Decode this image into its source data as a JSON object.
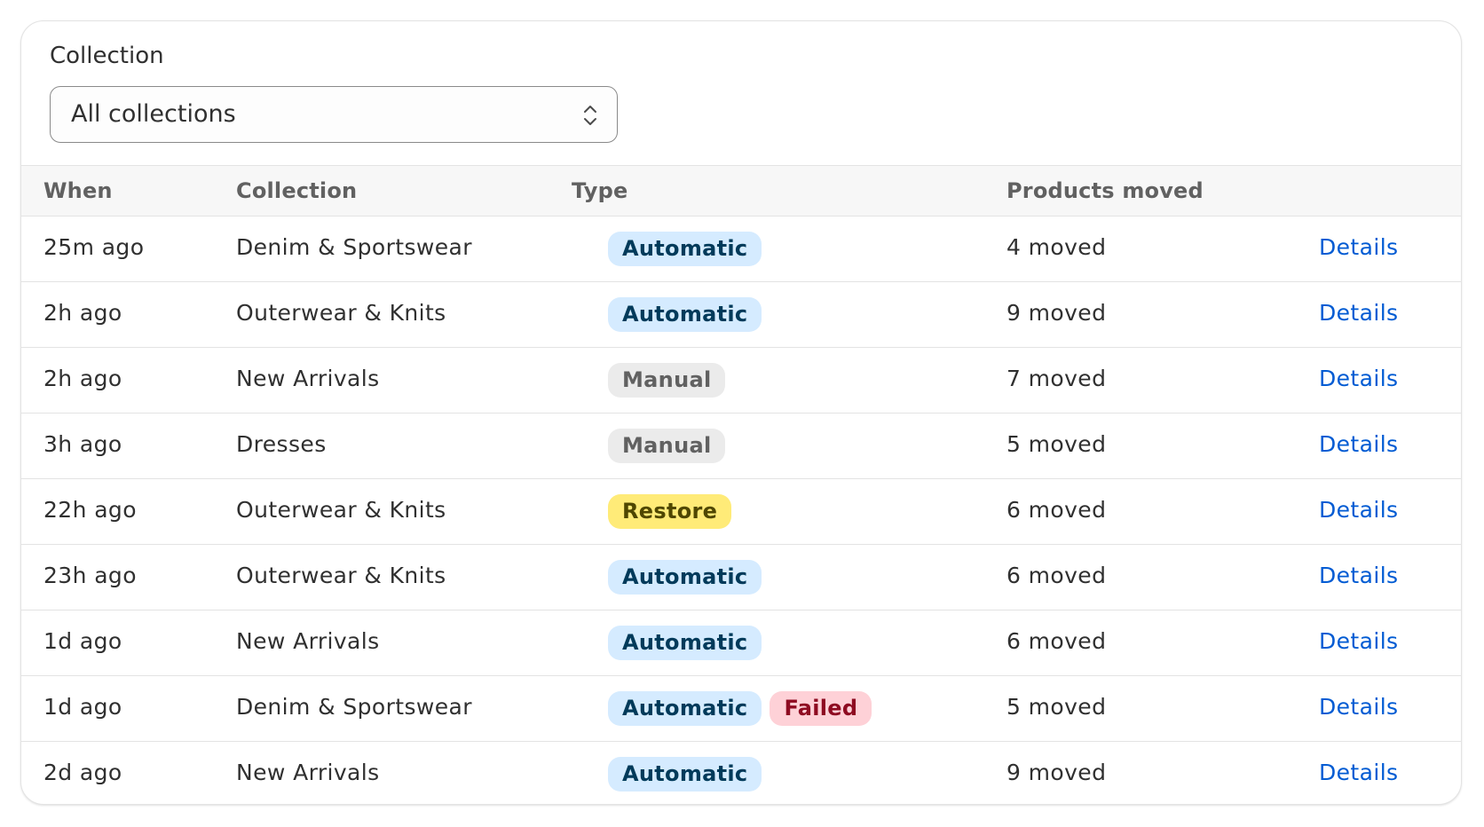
{
  "filter": {
    "label": "Collection",
    "selected": "All collections",
    "icon": "chevron-up-down-icon"
  },
  "table": {
    "headers": {
      "when": "When",
      "collection": "Collection",
      "type": "Type",
      "products_moved": "Products moved"
    },
    "rows": [
      {
        "when": "25m ago",
        "collection": "Denim & Sportswear",
        "types": [
          "Automatic"
        ],
        "moved": "4 moved",
        "action": "Details"
      },
      {
        "when": "2h ago",
        "collection": "Outerwear & Knits",
        "types": [
          "Automatic"
        ],
        "moved": "9 moved",
        "action": "Details"
      },
      {
        "when": "2h ago",
        "collection": "New Arrivals",
        "types": [
          "Manual"
        ],
        "moved": "7 moved",
        "action": "Details"
      },
      {
        "when": "3h ago",
        "collection": "Dresses",
        "types": [
          "Manual"
        ],
        "moved": "5 moved",
        "action": "Details"
      },
      {
        "when": "22h ago",
        "collection": "Outerwear & Knits",
        "types": [
          "Restore"
        ],
        "moved": "6 moved",
        "action": "Details"
      },
      {
        "when": "23h ago",
        "collection": "Outerwear & Knits",
        "types": [
          "Automatic"
        ],
        "moved": "6 moved",
        "action": "Details"
      },
      {
        "when": "1d ago",
        "collection": "New Arrivals",
        "types": [
          "Automatic"
        ],
        "moved": "6 moved",
        "action": "Details"
      },
      {
        "when": "1d ago",
        "collection": "Denim & Sportswear",
        "types": [
          "Automatic",
          "Failed"
        ],
        "moved": "5 moved",
        "action": "Details"
      },
      {
        "when": "2d ago",
        "collection": "New Arrivals",
        "types": [
          "Automatic"
        ],
        "moved": "9 moved",
        "action": "Details"
      }
    ]
  },
  "colors": {
    "link": "#005bd3",
    "automatic_badge": "#d5ebff",
    "manual_badge": "#ebebeb",
    "restore_badge": "#ffeb78",
    "failed_badge": "#fed1d7"
  }
}
